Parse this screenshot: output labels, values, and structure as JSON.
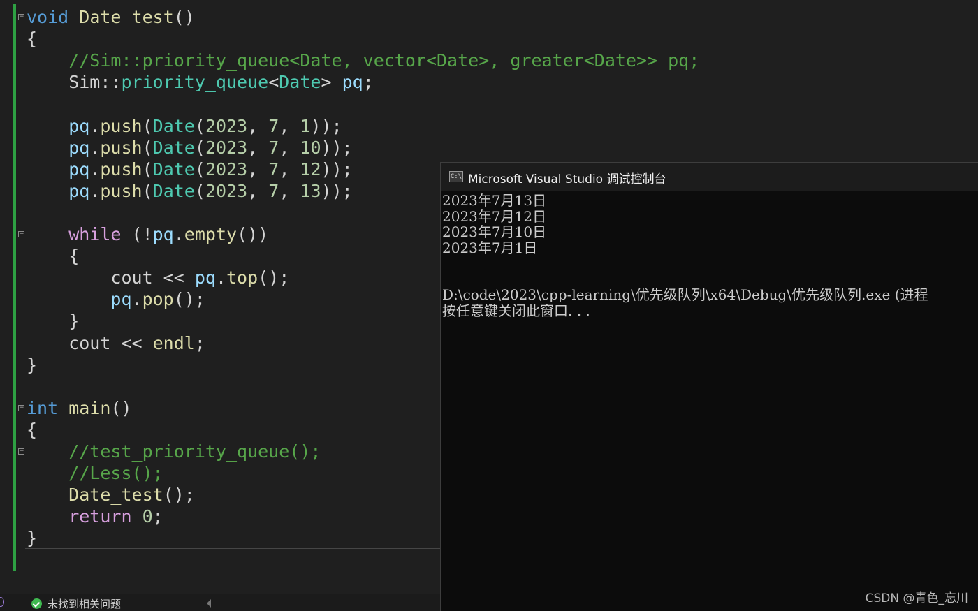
{
  "editor": {
    "lines": [
      {
        "id": "l1",
        "tokens": [
          [
            "kw",
            "void"
          ],
          [
            "pl",
            " "
          ],
          [
            "fn",
            "Date_test"
          ],
          [
            "pl",
            "()"
          ]
        ]
      },
      {
        "id": "l2",
        "tokens": [
          [
            "pl",
            "{"
          ]
        ]
      },
      {
        "id": "l3",
        "tokens": [
          [
            "cm",
            "    //Sim::priority_queue<Date, vector<Date>, greater<Date>> pq;"
          ]
        ]
      },
      {
        "id": "l4",
        "tokens": [
          [
            "pl",
            "    Sim"
          ],
          [
            "pl",
            "::"
          ],
          [
            "ty",
            "priority_queue"
          ],
          [
            "pl",
            "<"
          ],
          [
            "ty",
            "Date"
          ],
          [
            "pl",
            "> "
          ],
          [
            "var",
            "pq"
          ],
          [
            "pl",
            ";"
          ]
        ]
      },
      {
        "id": "l5",
        "tokens": [
          [
            "pl",
            ""
          ]
        ]
      },
      {
        "id": "l6",
        "tokens": [
          [
            "var",
            "    pq"
          ],
          [
            "pl",
            "."
          ],
          [
            "fn",
            "push"
          ],
          [
            "pl",
            "("
          ],
          [
            "ty",
            "Date"
          ],
          [
            "pl",
            "("
          ],
          [
            "num",
            "2023"
          ],
          [
            "pl",
            ", "
          ],
          [
            "num",
            "7"
          ],
          [
            "pl",
            ", "
          ],
          [
            "num",
            "1"
          ],
          [
            "pl",
            "));"
          ]
        ]
      },
      {
        "id": "l7",
        "tokens": [
          [
            "var",
            "    pq"
          ],
          [
            "pl",
            "."
          ],
          [
            "fn",
            "push"
          ],
          [
            "pl",
            "("
          ],
          [
            "ty",
            "Date"
          ],
          [
            "pl",
            "("
          ],
          [
            "num",
            "2023"
          ],
          [
            "pl",
            ", "
          ],
          [
            "num",
            "7"
          ],
          [
            "pl",
            ", "
          ],
          [
            "num",
            "10"
          ],
          [
            "pl",
            "));"
          ]
        ]
      },
      {
        "id": "l8",
        "tokens": [
          [
            "var",
            "    pq"
          ],
          [
            "pl",
            "."
          ],
          [
            "fn",
            "push"
          ],
          [
            "pl",
            "("
          ],
          [
            "ty",
            "Date"
          ],
          [
            "pl",
            "("
          ],
          [
            "num",
            "2023"
          ],
          [
            "pl",
            ", "
          ],
          [
            "num",
            "7"
          ],
          [
            "pl",
            ", "
          ],
          [
            "num",
            "12"
          ],
          [
            "pl",
            "));"
          ]
        ]
      },
      {
        "id": "l9",
        "tokens": [
          [
            "var",
            "    pq"
          ],
          [
            "pl",
            "."
          ],
          [
            "fn",
            "push"
          ],
          [
            "pl",
            "("
          ],
          [
            "ty",
            "Date"
          ],
          [
            "pl",
            "("
          ],
          [
            "num",
            "2023"
          ],
          [
            "pl",
            ", "
          ],
          [
            "num",
            "7"
          ],
          [
            "pl",
            ", "
          ],
          [
            "num",
            "13"
          ],
          [
            "pl",
            "));"
          ]
        ]
      },
      {
        "id": "l10",
        "tokens": [
          [
            "pl",
            ""
          ]
        ]
      },
      {
        "id": "l11",
        "tokens": [
          [
            "kw2",
            "    while"
          ],
          [
            "pl",
            " (!"
          ],
          [
            "var",
            "pq"
          ],
          [
            "pl",
            "."
          ],
          [
            "fn",
            "empty"
          ],
          [
            "pl",
            "())"
          ]
        ]
      },
      {
        "id": "l12",
        "tokens": [
          [
            "pl",
            "    {"
          ]
        ]
      },
      {
        "id": "l13",
        "tokens": [
          [
            "pl",
            "        cout "
          ],
          [
            "pl",
            "<< "
          ],
          [
            "var",
            "pq"
          ],
          [
            "pl",
            "."
          ],
          [
            "fn",
            "top"
          ],
          [
            "pl",
            "();"
          ]
        ]
      },
      {
        "id": "l14",
        "tokens": [
          [
            "var",
            "        pq"
          ],
          [
            "pl",
            "."
          ],
          [
            "fn",
            "pop"
          ],
          [
            "pl",
            "();"
          ]
        ]
      },
      {
        "id": "l15",
        "tokens": [
          [
            "pl",
            "    }"
          ]
        ]
      },
      {
        "id": "l16",
        "tokens": [
          [
            "pl",
            "    cout << "
          ],
          [
            "fn",
            "endl"
          ],
          [
            "pl",
            ";"
          ]
        ]
      },
      {
        "id": "l17",
        "tokens": [
          [
            "pl",
            "}"
          ]
        ]
      },
      {
        "id": "l18",
        "tokens": [
          [
            "pl",
            ""
          ]
        ]
      },
      {
        "id": "l19",
        "tokens": [
          [
            "kw",
            "int"
          ],
          [
            "pl",
            " "
          ],
          [
            "fn",
            "main"
          ],
          [
            "pl",
            "()"
          ]
        ]
      },
      {
        "id": "l20",
        "tokens": [
          [
            "pl",
            "{"
          ]
        ]
      },
      {
        "id": "l21",
        "tokens": [
          [
            "cm",
            "    //test_priority_queue();"
          ]
        ]
      },
      {
        "id": "l22",
        "tokens": [
          [
            "cm",
            "    //Less();"
          ]
        ]
      },
      {
        "id": "l23",
        "tokens": [
          [
            "fn",
            "    Date_test"
          ],
          [
            "pl",
            "();"
          ]
        ]
      },
      {
        "id": "l24",
        "tokens": [
          [
            "kw2",
            "    return"
          ],
          [
            "pl",
            " "
          ],
          [
            "num",
            "0"
          ],
          [
            "pl",
            ";"
          ]
        ]
      },
      {
        "id": "l25",
        "tokens": [
          [
            "pl",
            "}"
          ]
        ]
      }
    ]
  },
  "status": {
    "issues_text": "未找到相关问题"
  },
  "console": {
    "title": "Microsoft Visual Studio 调试控制台",
    "icon_text": "C:\\",
    "output": [
      "2023年7月13日",
      "2023年7月12日",
      "2023年7月10日",
      "2023年7月1日",
      "",
      "",
      "D:\\code\\2023\\cpp-learning\\优先级队列\\x64\\Debug\\优先级队列.exe (进程",
      "按任意键关闭此窗口. . ."
    ]
  },
  "watermark": "CSDN @青色_忘川"
}
